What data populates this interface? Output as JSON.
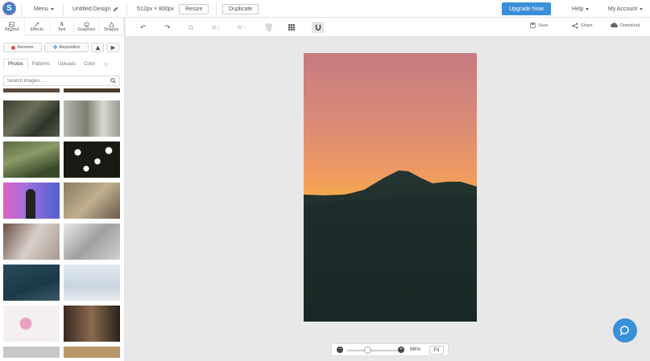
{
  "topbar": {
    "logo_letter": "S",
    "menu_label": "Menu",
    "design_title": "Untitled Design",
    "canvas_size": "512px × 800px",
    "resize_label": "Resize",
    "duplicate_label": "Duplicate",
    "upgrade_label": "Upgrade Now",
    "help_label": "Help",
    "account_label": "My Account"
  },
  "sidebar": {
    "tabs": [
      {
        "label": "Bkgrnd",
        "icon": "background-icon"
      },
      {
        "label": "Effects",
        "icon": "effects-icon"
      },
      {
        "label": "Text",
        "icon": "text-icon",
        "glyph": "A"
      },
      {
        "label": "Graphics",
        "icon": "graphics-icon"
      },
      {
        "label": "Shapes",
        "icon": "shapes-icon"
      }
    ],
    "remove_label": "Remove",
    "reposition_label": "Reposition",
    "subtabs": [
      "Photos",
      "Patterns",
      "Uploads",
      "Color"
    ],
    "search_placeholder": "Search images..."
  },
  "toolbar": {
    "save_label": "Save",
    "share_label": "Share",
    "download_label": "Download"
  },
  "zoom": {
    "level_label": "86%",
    "fit_label": "Fit",
    "level": 0.86
  },
  "colors": {
    "accent": "#3a8fd9",
    "sky_top": "#c97b7b",
    "sky_horizon": "#f0a050",
    "mountain": "#1e2f2e"
  }
}
